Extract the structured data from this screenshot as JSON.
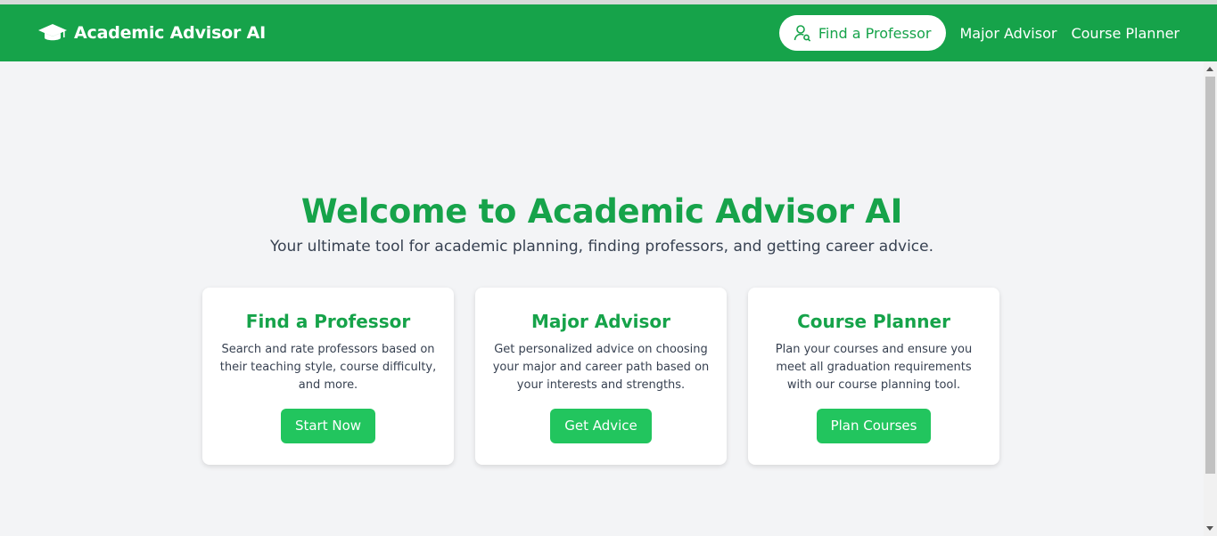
{
  "app": {
    "title": "Academic Advisor AI",
    "brand_icon": "graduation-cap-icon"
  },
  "nav": {
    "items": [
      {
        "label": "Find a Professor",
        "icon": "user-search-icon",
        "active": true
      },
      {
        "label": "Major Advisor"
      },
      {
        "label": "Course Planner"
      }
    ]
  },
  "hero": {
    "title": "Welcome to Academic Advisor AI",
    "subtitle": "Your ultimate tool for academic planning, finding professors, and getting career advice."
  },
  "cards": [
    {
      "title": "Find a Professor",
      "description": "Search and rate professors based on their teaching style, course difficulty, and more.",
      "button": "Start Now"
    },
    {
      "title": "Major Advisor",
      "description": "Get personalized advice on choosing your major and career path based on your interests and strengths.",
      "button": "Get Advice"
    },
    {
      "title": "Course Planner",
      "description": "Plan your courses and ensure you meet all graduation requirements with our course planning tool.",
      "button": "Plan Courses"
    }
  ],
  "colors": {
    "brand_green": "#16a34a",
    "button_green": "#22c55e",
    "background": "#f3f4f6"
  }
}
